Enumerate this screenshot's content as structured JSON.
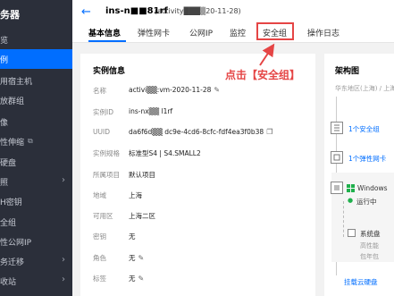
{
  "sidebar": {
    "title": "务器",
    "items": [
      {
        "label": "览",
        "active": false,
        "ext": false,
        "chevron": false
      },
      {
        "label": "例",
        "active": true,
        "ext": false,
        "chevron": false
      },
      {
        "label": "用宿主机",
        "active": false,
        "ext": false,
        "chevron": false
      },
      {
        "label": "放群组",
        "active": false,
        "ext": false,
        "chevron": false
      },
      {
        "label": "像",
        "active": false,
        "ext": false,
        "chevron": false
      },
      {
        "label": "性伸缩",
        "active": false,
        "ext": true,
        "chevron": false
      },
      {
        "label": "硬盘",
        "active": false,
        "ext": false,
        "chevron": false
      },
      {
        "label": "照",
        "active": false,
        "ext": false,
        "chevron": true
      },
      {
        "label": "H密钥",
        "active": false,
        "ext": false,
        "chevron": false
      },
      {
        "label": "全组",
        "active": false,
        "ext": false,
        "chevron": false
      },
      {
        "label": "性公网IP",
        "active": false,
        "ext": false,
        "chevron": false
      },
      {
        "label": "务迁移",
        "active": false,
        "ext": false,
        "chevron": true
      },
      {
        "label": "收站",
        "active": false,
        "ext": false,
        "chevron": true
      }
    ]
  },
  "header": {
    "instance_name": "ins-n■■81rf",
    "instance_sub": "(activity███▒20-11-28)"
  },
  "tabs": [
    {
      "label": "基本信息",
      "active": true
    },
    {
      "label": "弹性网卡",
      "active": false
    },
    {
      "label": "公网IP",
      "active": false
    },
    {
      "label": "监控",
      "active": false
    },
    {
      "label": "安全组",
      "active": false
    },
    {
      "label": "操作日志",
      "active": false
    }
  ],
  "annotation": "点击【安全组】",
  "instance_info": {
    "title": "实例信息",
    "rows": [
      {
        "label": "名称",
        "value": "activi▒▒:vm-2020-11-28",
        "editable": true
      },
      {
        "label": "实例ID",
        "value": "ins-nx▒▒ l1rf",
        "editable": false
      },
      {
        "label": "UUID",
        "value": "da6f6d▒▒ dc9e-4cd6-8cfc-fdf4ea3f0b38",
        "editable": false,
        "copyable": true
      },
      {
        "label": "实例规格",
        "value": "标准型S4 | S4.SMALL2",
        "editable": false
      },
      {
        "label": "所属项目",
        "value": "默认项目",
        "editable": false
      },
      {
        "label": "地域",
        "value": "上海",
        "editable": false
      },
      {
        "label": "可用区",
        "value": "上海二区",
        "editable": false
      },
      {
        "label": "密钥",
        "value": "无",
        "editable": false
      },
      {
        "label": "角色",
        "value": "无",
        "editable": true
      },
      {
        "label": "标签",
        "value": "无",
        "editable": true
      }
    ]
  },
  "architecture": {
    "title": "架构图",
    "region": "华东地区(上海) / 上海二",
    "security_group": "1个安全组",
    "nic": "1个弹性网卡",
    "os": "Windows",
    "status": "运行中",
    "system_disk": "系统盘",
    "disk_sub1": "高性能",
    "disk_sub2": "包年包",
    "mount_disk": "挂载云硬盘"
  },
  "colors": {
    "accent": "#006eff",
    "sidebar_bg": "#2b2f3a",
    "highlight": "#e54545",
    "running": "#1fb04c"
  }
}
